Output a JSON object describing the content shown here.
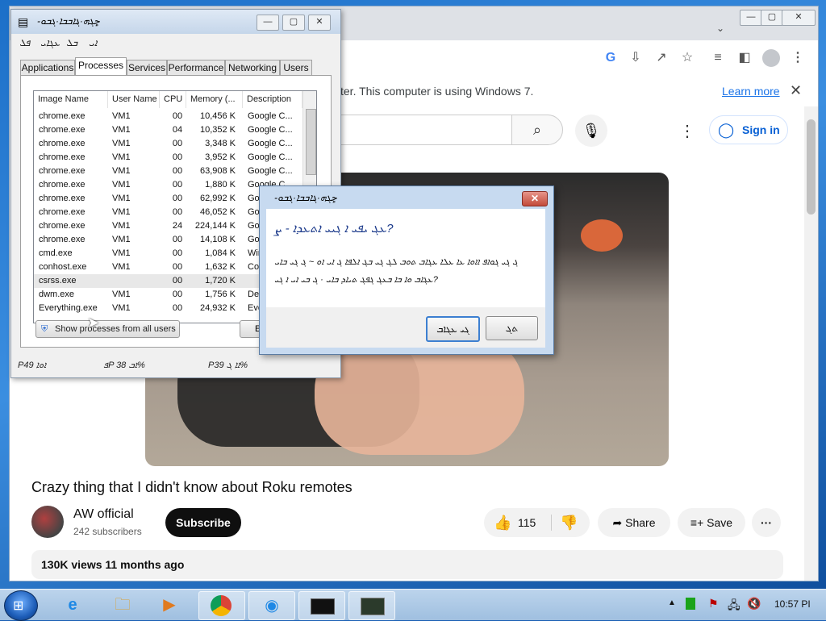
{
  "chrome": {
    "infobar_text": "ter. This computer is using Windows 7.",
    "learn_more": "Learn more",
    "close_glyph": "✕",
    "signin_label": "Sign in"
  },
  "video": {
    "title": "Crazy thing that I didn't know about Roku remotes",
    "channel": "AW official",
    "subscribers": "242 subscribers",
    "subscribe_label": "Subscribe",
    "likes": "115",
    "share_label": "Share",
    "save_label": "Save",
    "views_line": "130K views  11 months ago"
  },
  "taskmgr": {
    "title": "-ݮܓܗ·ܔܐܒܒܐ·ܓܒܘ",
    "menu": [
      "ܦܠ",
      "ܥܓܐܝ",
      "ܒܠ",
      "ܐܝ"
    ],
    "tabs": [
      "Applications",
      "Processes",
      "Services",
      "Performance",
      "Networking",
      "Users"
    ],
    "columns": [
      "Image Name",
      "User Name",
      "CPU",
      "Memory (...",
      "Description"
    ],
    "rows": [
      [
        "chrome.exe",
        "VM1",
        "00",
        "10,456 K",
        "Google C..."
      ],
      [
        "chrome.exe",
        "VM1",
        "04",
        "10,352 K",
        "Google C..."
      ],
      [
        "chrome.exe",
        "VM1",
        "00",
        "3,348 K",
        "Google C..."
      ],
      [
        "chrome.exe",
        "VM1",
        "00",
        "3,952 K",
        "Google C..."
      ],
      [
        "chrome.exe",
        "VM1",
        "00",
        "63,908 K",
        "Google C..."
      ],
      [
        "chrome.exe",
        "VM1",
        "00",
        "1,880 K",
        "Google C..."
      ],
      [
        "chrome.exe",
        "VM1",
        "00",
        "62,992 K",
        "Goo"
      ],
      [
        "chrome.exe",
        "VM1",
        "00",
        "46,052 K",
        "Goo"
      ],
      [
        "chrome.exe",
        "VM1",
        "24",
        "224,144 K",
        "Goo"
      ],
      [
        "chrome.exe",
        "VM1",
        "00",
        "14,108 K",
        "Goo"
      ],
      [
        "cmd.exe",
        "VM1",
        "00",
        "1,084 K",
        "Win"
      ],
      [
        "conhost.exe",
        "VM1",
        "00",
        "1,632 K",
        "Con"
      ],
      [
        "csrss.exe",
        "",
        "00",
        "1,720 K",
        ""
      ],
      [
        "dwm.exe",
        "VM1",
        "00",
        "1,756 K",
        "Des"
      ],
      [
        "Everything.exe",
        "VM1",
        "00",
        "24,932 K",
        "Eve"
      ]
    ],
    "show_all_label": "Show processes from all users",
    "end_label": "E",
    "status_processes": "Pܐܘܐ 49",
    "status_cpu": "ܦP ܐܒ 38%",
    "status_memory": "Pܐܐ ܓ 39%"
  },
  "dialog": {
    "title": "-ݮܓܗ·ܔܐܒܒܐ·ܓܒܘ",
    "heading": "ܥܓ ܝܦܝ ܐ ܓܝܝ ܐܬܥܕܐ - ܨ?",
    "body_line1": "ܓ ܓܝ ܓܘܐܦ ܐܐܘܐ ܥܐ ܥܠܐ ܥܓܐܒ ܬܘܒ ܠܓ ܓܝ ܒܓ ܐܠܦܐ ܓ ܐܝ ܐܘ ~ ܓ ܓܝ ܒܐܝ",
    "body_line2": "ܥܓܐܒ ܘܐ ܒܐ ܒܥܓ ܓܦܓ ܬܝܐܕ ܒܐܝ · ܓ ܒܝ ܐܝ ܐ ܓܝ?",
    "yes_label": "ܓܝ ܥܓܐܒ",
    "no_label": "ܬܓ"
  },
  "taskbar": {
    "items": [
      "ie",
      "explorer",
      "media",
      "chrome",
      "edge",
      "cmd",
      "taskmgr"
    ],
    "clock": "10:57 PI"
  }
}
